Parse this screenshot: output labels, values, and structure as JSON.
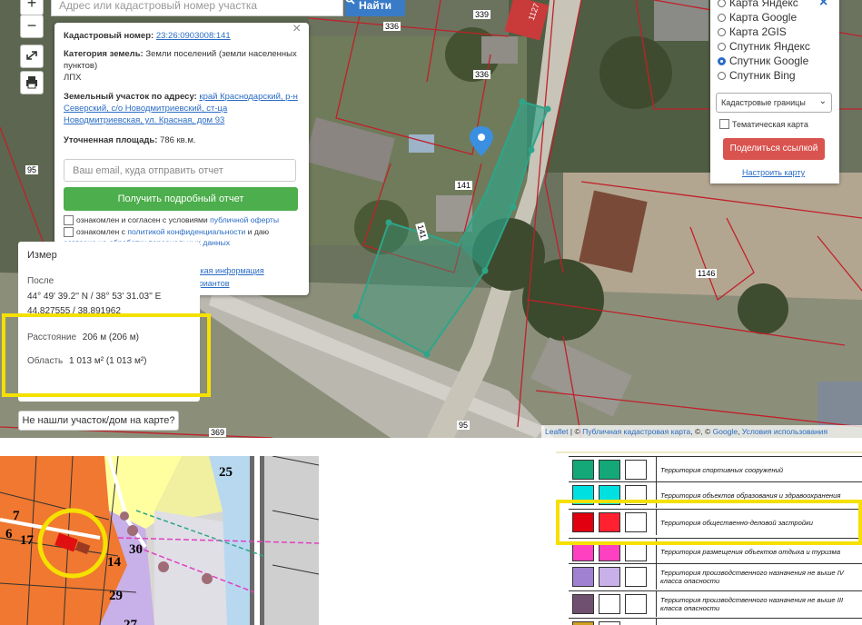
{
  "search": {
    "placeholder": "Адрес или кадастровый номер участка",
    "button": "Найти"
  },
  "zoom": {
    "in": "+",
    "out": "−"
  },
  "map_labels": [
    "339",
    "1127",
    "336",
    "336",
    "95",
    "141",
    "141",
    "1146",
    "95",
    "369"
  ],
  "popup": {
    "cadastral_label": "Кадастровый номер:",
    "cadastral_value": "23:26:0903008:141",
    "category_label": "Категория земель:",
    "category_value": "Земли поселений (земли населенных пунктов)",
    "use": "ЛПХ",
    "address_label": "Земельный участок по адресу:",
    "address_value": "край Краснодарский, р-н Северский, с/о Новодмитриевский, ст-ца Новодмитриевская, ул. Красная, дом 93",
    "area_label": "Уточненная площадь:",
    "area_value": "786 кв.м.",
    "email_placeholder": "Ваш email, куда отправить отчет",
    "report_button": "Получить подробный отчет",
    "agree1_text": "ознакомлен и согласен с условиями",
    "agree1_link": "публичной оферты",
    "agree2_text": "ознакомлен с",
    "agree2_link": "политикой конфиденциальности",
    "agree2_text2": "и даю",
    "agree2_link2": "согласие на обработку персональных данных",
    "details_link": "Детали отчета и юридическая информация",
    "manual_link": "Ручной выбор вариантов",
    "close": "×"
  },
  "layers": {
    "close": "×",
    "options": [
      {
        "label": "Карта Яндекс",
        "selected": false
      },
      {
        "label": "Карта Google",
        "selected": false
      },
      {
        "label": "Карта 2GIS",
        "selected": false
      },
      {
        "label": "Спутник Яндекс",
        "selected": false
      },
      {
        "label": "Спутник Google",
        "selected": true
      },
      {
        "label": "Спутник Bing",
        "selected": false
      }
    ],
    "select_value": "Кадастровые границы",
    "thematic_label": "Тематическая карта",
    "share_button": "Поделиться ссылкой",
    "setup_link": "Настроить карту"
  },
  "measure": {
    "title": "Измер",
    "last_label": "После",
    "coords1": "44° 49' 39.2'' N / 38° 53' 31.03'' E",
    "coords2": "44.827555 / 38.891962",
    "distance_label": "Расстояние",
    "distance_value": "206 м (206 м)",
    "area_label": "Область",
    "area_value": "1 013 м² (1 013 м²)"
  },
  "not_found": "Не нашли участок/дом на карте?",
  "attribution": {
    "leaflet": "Leaflet",
    "text1": " | © ",
    "pkk": "Публичная кадастровая карта",
    "text2": ", ©, © ",
    "google": "Google",
    "text3": ", ",
    "terms": "Условия использования"
  },
  "plan_labels": [
    "25",
    "7",
    "6",
    "17",
    "30",
    "14",
    "29",
    "27"
  ],
  "legend": [
    {
      "label": "Территория спортивных сооружений",
      "colors": [
        "#14a878",
        "#14a878"
      ]
    },
    {
      "label": "Территория объектов образования и здравоохранения",
      "colors": [
        "#00e0e0",
        "#00e0e0"
      ]
    },
    {
      "label": "Территория общественно-деловой застройки",
      "colors": [
        "#e00010",
        "#ff2030"
      ]
    },
    {
      "label": "Территория размещения объектов отдыха и туризма",
      "colors": [
        "#ff40c0",
        "#ff40c0"
      ]
    },
    {
      "label": "Территория производственного назначения не выше IV класса опасности",
      "colors": [
        "#a080d0",
        "#c8b0e8"
      ]
    },
    {
      "label": "Территория производственного назначения не выше III класса опасности",
      "colors": [
        "#705070",
        "#ffffff"
      ]
    },
    {
      "label": "",
      "colors": [
        "#d0a020",
        "#ffffff"
      ]
    }
  ],
  "colors": {
    "highlight": "#f5e000",
    "parcel": "#2ea58a",
    "cadastral_line": "#c0202a",
    "share": "#d9534f",
    "report": "#4cae4c",
    "link": "#2a6cc4"
  }
}
